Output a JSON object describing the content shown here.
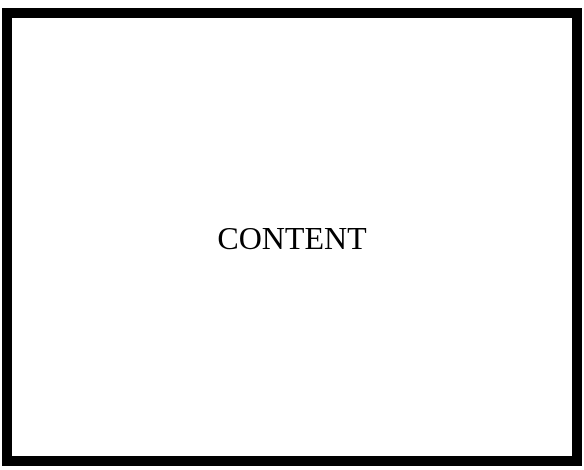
{
  "main": {
    "content_label": "CONTENT"
  },
  "colors": {
    "border": "#000000",
    "background": "#ffffff",
    "text": "#000000"
  }
}
